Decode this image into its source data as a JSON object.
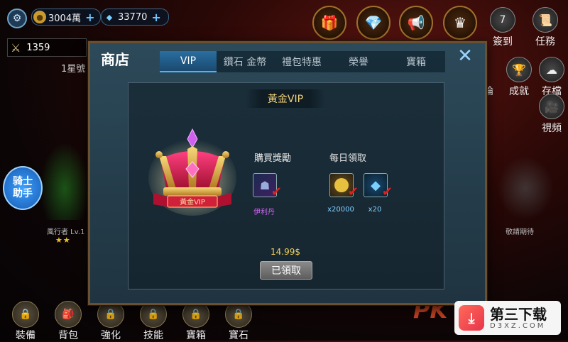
{
  "topbar": {
    "gold": "3004萬",
    "diamonds": "33770",
    "power": "1359",
    "star_label": "1星號",
    "right_icons": [
      "簽到",
      "任務"
    ],
    "plus": "+"
  },
  "side_buttons": [
    "論",
    "成就",
    "存檔",
    "視頻"
  ],
  "helper": {
    "line1": "骑士",
    "line2": "助手"
  },
  "character": {
    "label": "風行者 Lv.1",
    "stars": "★★"
  },
  "right_label": "敬請期待",
  "bottom_nav": [
    "裝備",
    "背包",
    "強化",
    "技能",
    "寶箱",
    "寶石"
  ],
  "shop": {
    "title": "商店",
    "tabs": [
      "VIP",
      "鑽石 金幣",
      "禮包特惠",
      "榮譽",
      "寶箱"
    ],
    "active_tab": "VIP",
    "close": "✕",
    "vip_header": "黃金VIP",
    "crown_ribbon": "黃金VIP",
    "purchase_section": "購買獎勵",
    "daily_section": "每日領取",
    "purchase_rewards": [
      {
        "label": "伊利丹"
      }
    ],
    "daily_rewards": [
      {
        "label": "x20000"
      },
      {
        "label": "x20"
      }
    ],
    "price": "14.99$",
    "claim_button": "已領取"
  },
  "watermark": {
    "brand": "第三下载",
    "domain": "D3XZ.COM"
  },
  "pk_text": "PK"
}
